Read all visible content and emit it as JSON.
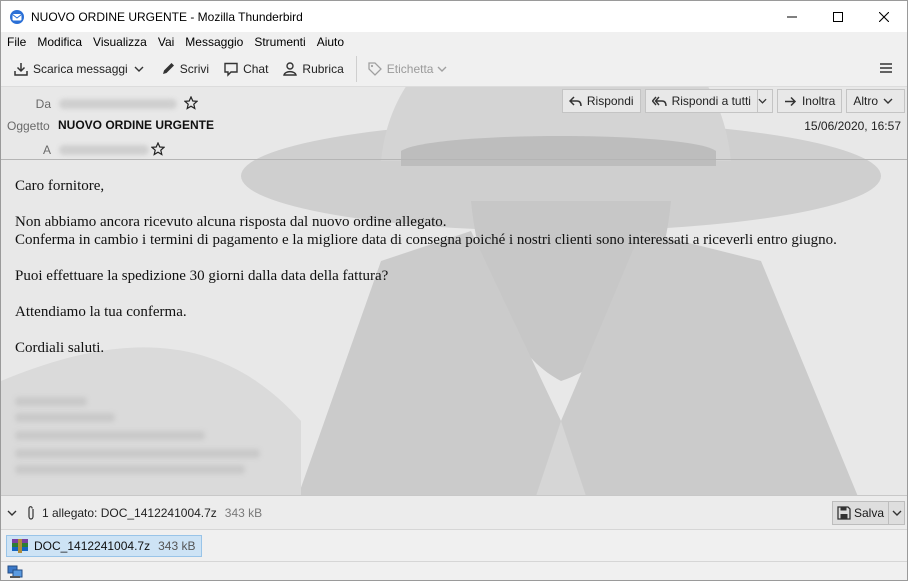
{
  "window": {
    "title": "NUOVO ORDINE URGENTE - Mozilla Thunderbird"
  },
  "menu": [
    "File",
    "Modifica",
    "Visualizza",
    "Vai",
    "Messaggio",
    "Strumenti",
    "Aiuto"
  ],
  "toolbar": {
    "get_messages": "Scarica messaggi",
    "write": "Scrivi",
    "chat": "Chat",
    "address_book": "Rubrica",
    "tag": "Etichetta"
  },
  "header": {
    "from_label": "Da",
    "subject_label": "Oggetto",
    "to_label": "A",
    "subject": "NUOVO ORDINE URGENTE",
    "date": "15/06/2020, 16:57",
    "reply": "Rispondi",
    "reply_all": "Rispondi a tutti",
    "forward": "Inoltra",
    "more": "Altro"
  },
  "body": {
    "greeting": "Caro fornitore,",
    "para1": "Non abbiamo ancora ricevuto alcuna risposta dal nuovo ordine allegato.",
    "para2": "Conferma in cambio i termini di pagamento e la migliore data di consegna poiché i nostri clienti sono interessati a riceverli entro giugno.",
    "para3": "Puoi effettuare la spedizione 30 giorni dalla data della fattura?",
    "para4": "Attendiamo la tua conferma.",
    "closing": "Cordiali saluti."
  },
  "attachments": {
    "summary": "1 allegato: DOC_1412241004.7z",
    "summary_size": "343 kB",
    "save": "Salva",
    "items": [
      {
        "name": "DOC_1412241004.7z",
        "size": "343 kB"
      }
    ]
  },
  "colors": {
    "accent": "#0a84ff",
    "selected_attachment": "#cde3f5"
  }
}
